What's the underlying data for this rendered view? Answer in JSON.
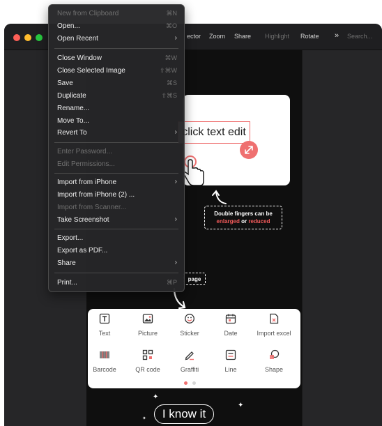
{
  "toolbar": {
    "inspector": "ector",
    "zoom": "Zoom",
    "share": "Share",
    "highlight": "Highlight",
    "rotate": "Rotate",
    "more": "»",
    "search": "Search..."
  },
  "colors": {
    "close": "#fe5f57",
    "minimize": "#febc2e",
    "zoom": "#28c840",
    "accent_red": "#ef7070"
  },
  "demo": {
    "edit_text": "click text edit",
    "zoom_tip_line1": "Double fingers can be",
    "zoom_tip_enlarged": "enlarged",
    "zoom_tip_or": " or ",
    "zoom_tip_reduced": "reduced",
    "page_tip": "page",
    "confirm": "I know it"
  },
  "tools": [
    {
      "label": "Text",
      "icon": "text-icon"
    },
    {
      "label": "Picture",
      "icon": "picture-icon"
    },
    {
      "label": "Sticker",
      "icon": "sticker-icon"
    },
    {
      "label": "Date",
      "icon": "date-icon"
    },
    {
      "label": "Import excel",
      "icon": "import-excel-icon"
    },
    {
      "label": "Barcode",
      "icon": "barcode-icon"
    },
    {
      "label": "QR code",
      "icon": "qr-code-icon"
    },
    {
      "label": "Graffiti",
      "icon": "graffiti-icon"
    },
    {
      "label": "Line",
      "icon": "line-icon"
    },
    {
      "label": "Shape",
      "icon": "shape-icon"
    }
  ],
  "menu": {
    "new_from_clipboard": {
      "label": "New from Clipboard",
      "shortcut": "⌘N"
    },
    "open": {
      "label": "Open...",
      "shortcut": "⌘O"
    },
    "open_recent": {
      "label": "Open Recent"
    },
    "close_window": {
      "label": "Close Window",
      "shortcut": "⌘W"
    },
    "close_selected_image": {
      "label": "Close Selected Image",
      "shortcut": "⇧⌘W"
    },
    "save": {
      "label": "Save",
      "shortcut": "⌘S"
    },
    "duplicate": {
      "label": "Duplicate",
      "shortcut": "⇧⌘S"
    },
    "rename": {
      "label": "Rename..."
    },
    "move_to": {
      "label": "Move To..."
    },
    "revert_to": {
      "label": "Revert To"
    },
    "enter_password": {
      "label": "Enter Password..."
    },
    "edit_permissions": {
      "label": "Edit Permissions..."
    },
    "import_iphone": {
      "label": "Import from iPhone"
    },
    "import_iphone_2": {
      "label": "Import from iPhone (2) ..."
    },
    "import_scanner": {
      "label": "Import from Scanner..."
    },
    "take_screenshot": {
      "label": "Take Screenshot"
    },
    "export": {
      "label": "Export..."
    },
    "export_pdf": {
      "label": "Export as PDF..."
    },
    "share": {
      "label": "Share"
    },
    "print": {
      "label": "Print...",
      "shortcut": "⌘P"
    }
  }
}
